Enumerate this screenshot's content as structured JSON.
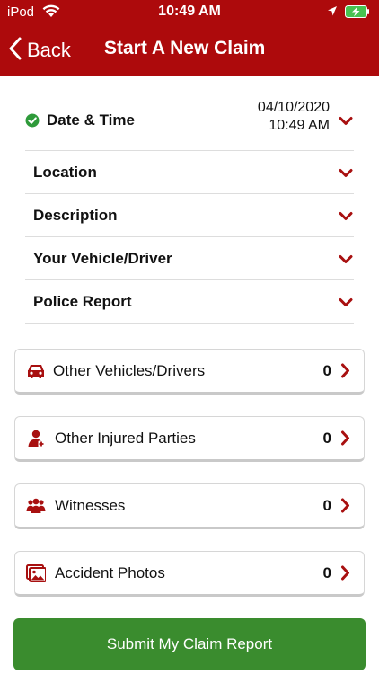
{
  "status_bar": {
    "carrier": "iPod",
    "time": "10:49 AM"
  },
  "nav": {
    "back_label": "Back",
    "title": "Start A New Claim"
  },
  "sections": {
    "date_time": {
      "label": "Date & Time",
      "date": "04/10/2020",
      "time": "10:49 AM",
      "completed": true
    },
    "location": {
      "label": "Location"
    },
    "description": {
      "label": "Description"
    },
    "vehicle": {
      "label": "Your Vehicle/Driver"
    },
    "police": {
      "label": "Police Report"
    }
  },
  "cards": {
    "other_vehicles": {
      "label": "Other Vehicles/Drivers",
      "count": "0",
      "icon": "car-icon"
    },
    "injured": {
      "label": "Other Injured Parties",
      "count": "0",
      "icon": "injured-person-icon"
    },
    "witnesses": {
      "label": "Witnesses",
      "count": "0",
      "icon": "people-group-icon"
    },
    "photos": {
      "label": "Accident Photos",
      "count": "0",
      "icon": "photo-icon"
    }
  },
  "submit": {
    "label": "Submit My Claim Report"
  },
  "colors": {
    "brand_red": "#ad0a0c",
    "accent_red": "#a81010",
    "submit_green": "#3a8c2e",
    "check_green": "#2e9a3a"
  }
}
